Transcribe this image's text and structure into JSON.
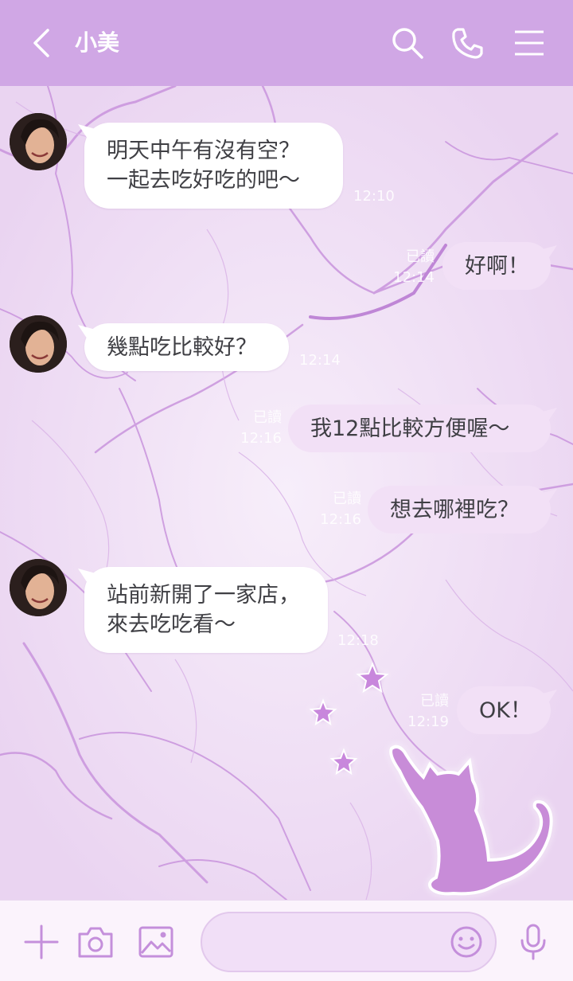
{
  "header": {
    "title": "小美",
    "bg_color": "#d0a7e5"
  },
  "messages": [
    {
      "side": "in",
      "lines": [
        "明天中午有沒有空？",
        "一起去吃好吃的吧～"
      ],
      "time": "12:10"
    },
    {
      "side": "out",
      "lines": [
        "好啊！"
      ],
      "read": "已讀",
      "time": "12:14"
    },
    {
      "side": "in",
      "lines": [
        "幾點吃比較好？"
      ],
      "time": "12:14"
    },
    {
      "side": "out",
      "lines": [
        "我12點比較方便喔～"
      ],
      "read": "已讀",
      "time": "12:16"
    },
    {
      "side": "out",
      "lines": [
        "想去哪裡吃？"
      ],
      "read": "已讀",
      "time": "12:16"
    },
    {
      "side": "in",
      "lines": [
        "站前新開了一家店，",
        "來去吃吃看～"
      ],
      "time": "12:18"
    },
    {
      "side": "out",
      "lines": [
        "OK！"
      ],
      "read": "已讀",
      "time": "12:19"
    }
  ],
  "input": {
    "placeholder": ""
  },
  "icons": {
    "back": "chevron-left-icon",
    "search": "search-icon",
    "call": "phone-icon",
    "menu": "hamburger-menu-icon",
    "plus": "plus-icon",
    "camera": "camera-icon",
    "image": "image-icon",
    "emoji": "emoji-icon",
    "mic": "microphone-icon"
  },
  "colors": {
    "accent": "#d0a7e5",
    "icon_purple": "#c48fdb",
    "cat": "#c88cd8"
  }
}
